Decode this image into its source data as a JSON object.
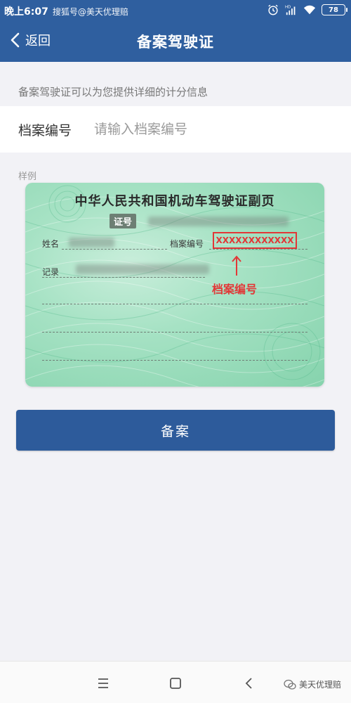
{
  "status_bar": {
    "time": "晚上6:07",
    "watermark": "搜狐号@美天优理赔",
    "battery": "78",
    "icons": [
      "alarm-icon",
      "hd-signal-icon",
      "wifi-icon",
      "battery-icon"
    ]
  },
  "app_bar": {
    "back_label": "返回",
    "title": "备案驾驶证"
  },
  "description": "备案驾驶证可以为您提供详细的计分信息",
  "form": {
    "field_label": "档案编号",
    "field_value": "",
    "field_placeholder": "请输入档案编号"
  },
  "sample": {
    "label": "样例",
    "card_title": "中华人民共和国机动车驾驶证副页",
    "card_tag": "证号",
    "name_label": "姓名",
    "file_no_label": "档案编号",
    "record_label": "记录",
    "sample_value": "XXXXXXXXXXXX",
    "arrow_label": "档案编号"
  },
  "submit_label": "备案",
  "footer": {
    "brand": "美天优理赔",
    "nav_icons": [
      "menu-icon",
      "home-icon",
      "back-icon"
    ]
  },
  "colors": {
    "primary": "#2f5f9f",
    "button": "#2d5b9b",
    "highlight": "#e23737",
    "card": "#a6e2c4"
  }
}
